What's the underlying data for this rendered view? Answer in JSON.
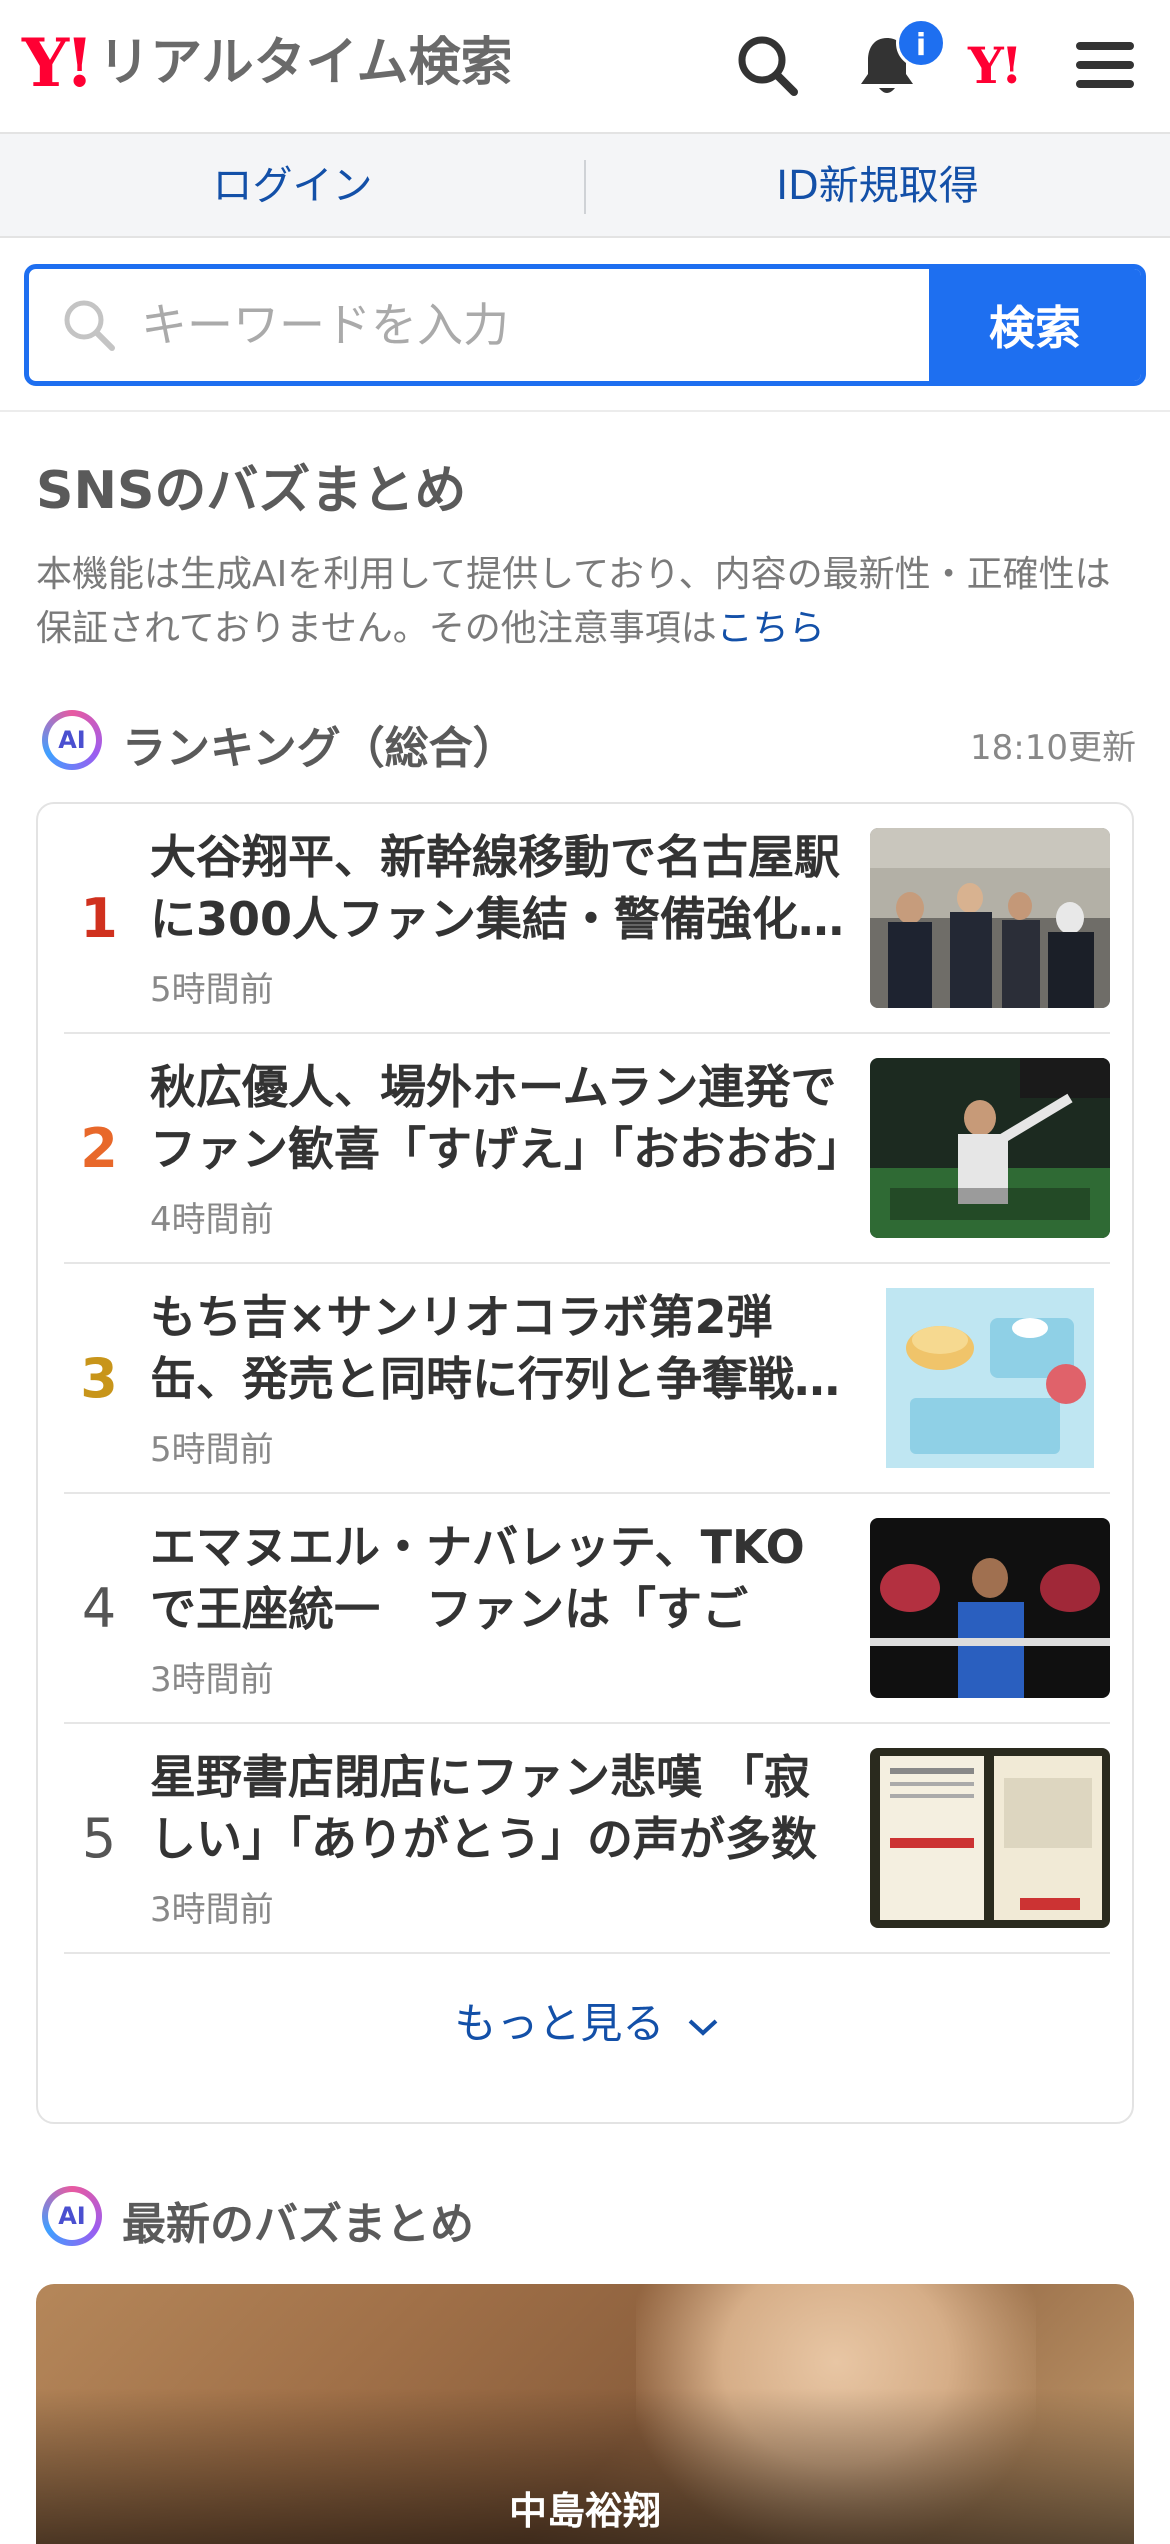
{
  "header": {
    "logo_mark": "Y!",
    "logo_text": "リアルタイム検索",
    "notification_badge": "i",
    "yjapan_mark": "Y!",
    "icons": [
      "search-icon",
      "bell-icon",
      "yahoo-japan-icon",
      "hamburger-menu-icon"
    ]
  },
  "account": {
    "login_label": "ログイン",
    "signup_label": "ID新規取得"
  },
  "search": {
    "placeholder": "キーワードを入力",
    "button_label": "検索"
  },
  "buzz": {
    "title": "SNSのバズまとめ",
    "notice_text": "本機能は生成AIを利用して提供しており、内容の最新性・正確性は保証されておりません。その他注意事項は",
    "notice_link": "こちら"
  },
  "ranking": {
    "badge": "AI",
    "title": "ランキング（総合）",
    "updated": "18:10更新",
    "items": [
      {
        "rank": "1",
        "title": "大谷翔平、新幹線移動で名古屋駅に300人ファン集結・警備強化…",
        "time": "5時間前",
        "rank_color": "#d0311e"
      },
      {
        "rank": "2",
        "title": "秋広優人、場外ホームラン連発でファン歓喜「すげえ」「おおおお」",
        "time": "4時間前",
        "rank_color": "#e8682a"
      },
      {
        "rank": "3",
        "title": "もち吉×サンリオコラボ第2弾 缶、発売と同時に行列と争奪戦…",
        "time": "5時間前",
        "rank_color": "#c8951a"
      },
      {
        "rank": "4",
        "title": "エマヌエル・ナバレッテ、TKOで王座統一　ファンは「すごい」…",
        "time": "3時間前",
        "rank_color": "#555555"
      },
      {
        "rank": "5",
        "title": "星野書店閉店にファン悲嘆 「寂しい」「ありがとう」の声が多数",
        "time": "3時間前",
        "rank_color": "#555555"
      }
    ],
    "more_label": "もっと見る"
  },
  "latest": {
    "badge": "AI",
    "title": "最新のバズまとめ",
    "card_caption": "中島裕翔"
  },
  "colors": {
    "accent": "#1e6ff0",
    "brand_red": "#ff0033",
    "link": "#1350a8"
  }
}
